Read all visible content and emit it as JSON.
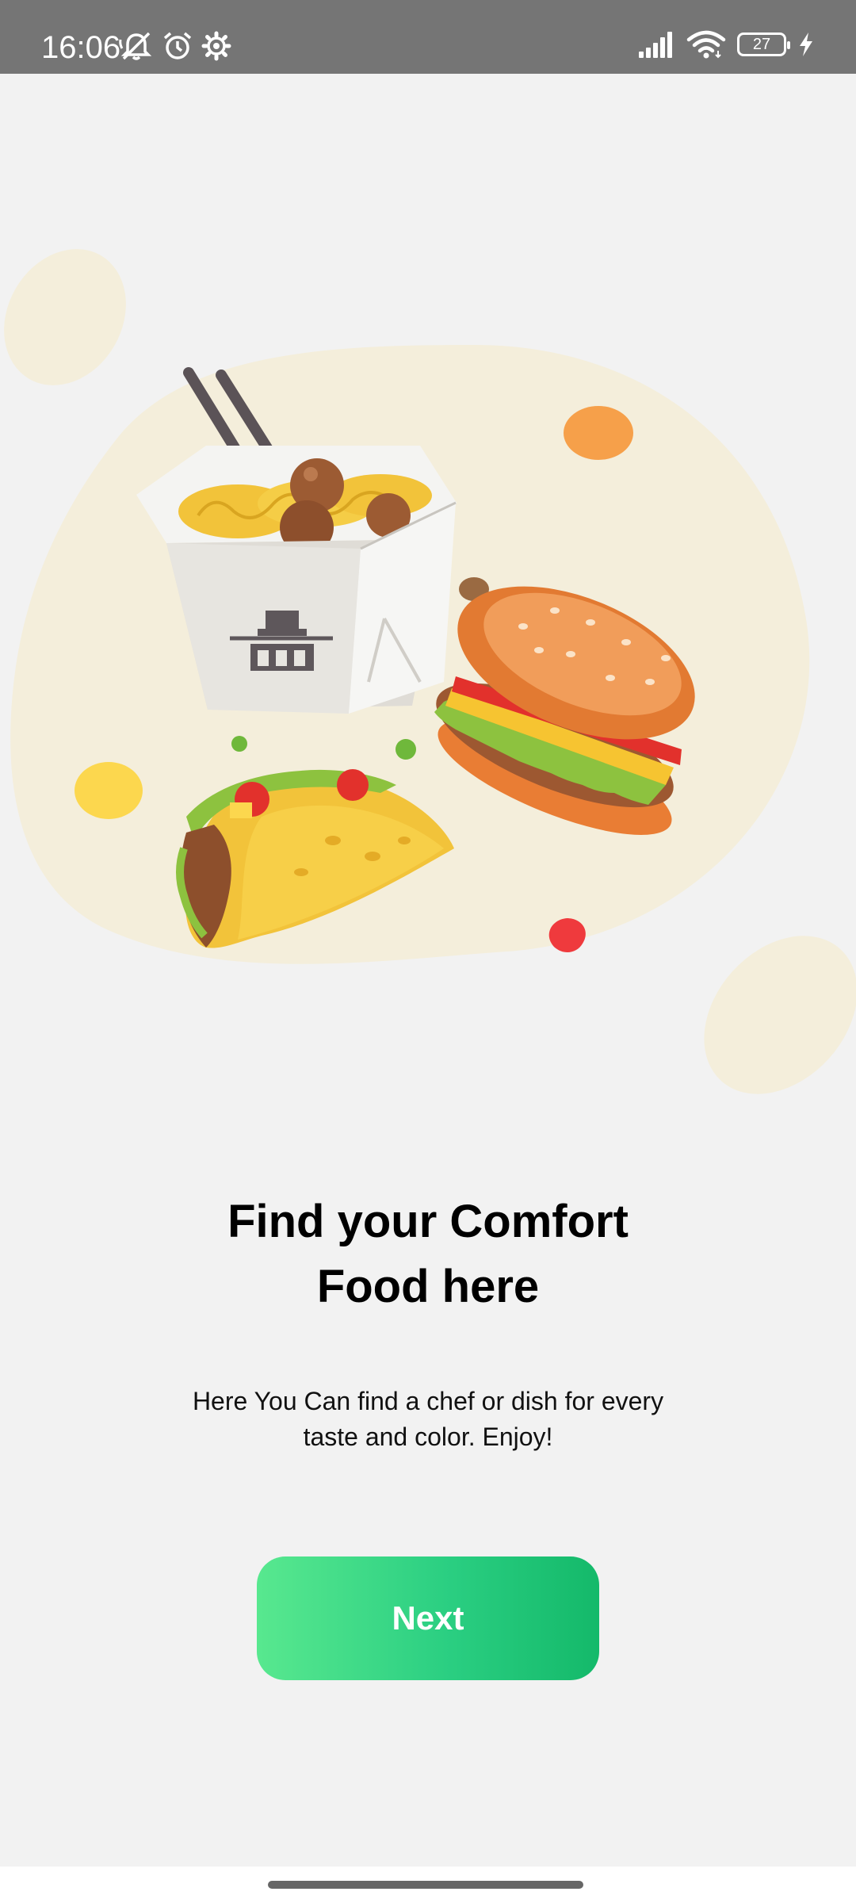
{
  "status_bar": {
    "time": "16:06",
    "battery_level": "27",
    "icons": [
      "mute-icon",
      "alarm-icon",
      "settings-icon",
      "signal-icon",
      "wifi-icon",
      "battery-icon",
      "charging-icon"
    ]
  },
  "onboarding": {
    "title_line1": "Find your Comfort",
    "title_line2": "Food here",
    "description_line1": "Here You Can find a chef or dish for every",
    "description_line2": "taste and color. Enjoy!",
    "next_label": "Next"
  },
  "colors": {
    "background": "#f2f2f2",
    "blob": "#f4eedb",
    "button_gradient_start": "#58e88f",
    "button_gradient_end": "#14b96a"
  }
}
